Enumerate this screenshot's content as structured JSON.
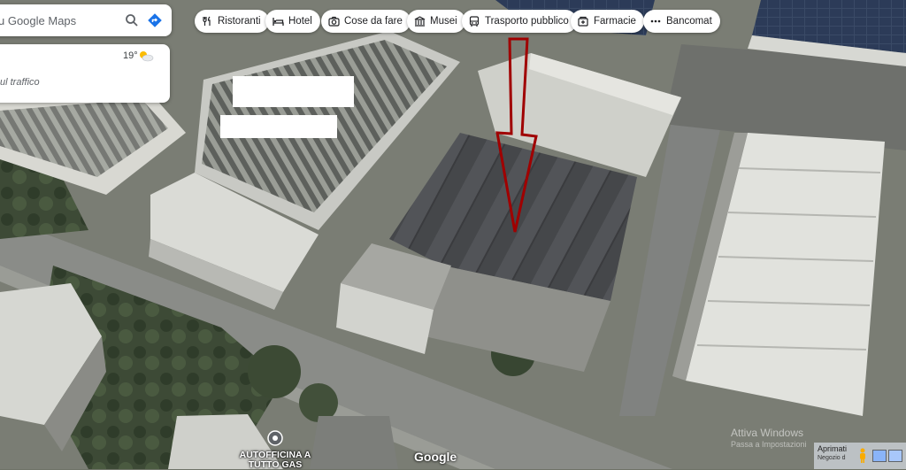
{
  "search": {
    "placeholder": "u Google Maps",
    "icons": [
      "search-icon",
      "directions-icon"
    ],
    "directions_color": "#1a73e8"
  },
  "categories": [
    {
      "label": "Ristoranti",
      "icon": "restaurant-icon"
    },
    {
      "label": "Hotel",
      "icon": "hotel-icon"
    },
    {
      "label": "Cose da fare",
      "icon": "camera-icon"
    },
    {
      "label": "Musei",
      "icon": "museum-icon"
    },
    {
      "label": "Trasporto pubblico",
      "icon": "bus-icon"
    },
    {
      "label": "Farmacie",
      "icon": "pharmacy-icon"
    },
    {
      "label": "Bancomat",
      "icon": "more-icon"
    }
  ],
  "weather": {
    "temperature": "19°",
    "icon": "partly-cloudy-icon",
    "traffic_text": "ul traffico"
  },
  "map": {
    "view": "satellite",
    "marker_label": "AUTOFFICINA A TUTTO GAS",
    "arrow_color": "#a00000",
    "logo": "Google"
  },
  "watermark": {
    "title": "Attiva Windows",
    "subtitle": "Passa a Impostazioni"
  },
  "taskbar": {
    "label": "Aprimati",
    "sublabel": "Negozio d"
  }
}
